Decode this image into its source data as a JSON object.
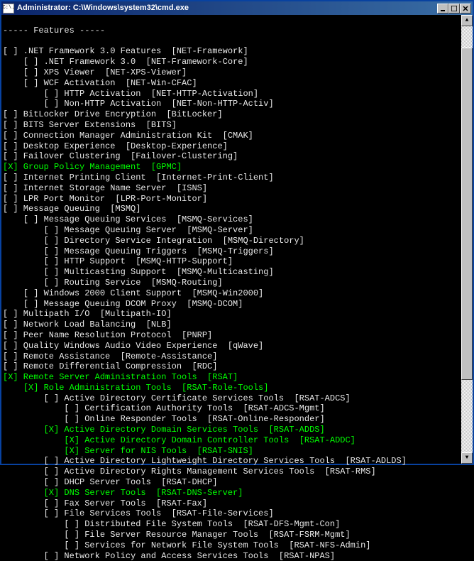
{
  "window": {
    "title": "Administrator: C:\\Windows\\system32\\cmd.exe",
    "icon_label": "C:\\."
  },
  "header": "----- Features -----",
  "lines": [
    {
      "indent": 0,
      "checked": false,
      "hl": false,
      "name": ".NET Framework 3.0 Features",
      "code": "NET-Framework"
    },
    {
      "indent": 1,
      "checked": false,
      "hl": false,
      "name": ".NET Framework 3.0",
      "code": "NET-Framework-Core"
    },
    {
      "indent": 1,
      "checked": false,
      "hl": false,
      "name": "XPS Viewer",
      "code": "NET-XPS-Viewer"
    },
    {
      "indent": 1,
      "checked": false,
      "hl": false,
      "name": "WCF Activation",
      "code": "NET-Win-CFAC"
    },
    {
      "indent": 2,
      "checked": false,
      "hl": false,
      "name": "HTTP Activation",
      "code": "NET-HTTP-Activation"
    },
    {
      "indent": 2,
      "checked": false,
      "hl": false,
      "name": "Non-HTTP Activation",
      "code": "NET-Non-HTTP-Activ"
    },
    {
      "indent": 0,
      "checked": false,
      "hl": false,
      "name": "BitLocker Drive Encryption",
      "code": "BitLocker"
    },
    {
      "indent": 0,
      "checked": false,
      "hl": false,
      "name": "BITS Server Extensions",
      "code": "BITS"
    },
    {
      "indent": 0,
      "checked": false,
      "hl": false,
      "name": "Connection Manager Administration Kit",
      "code": "CMAK"
    },
    {
      "indent": 0,
      "checked": false,
      "hl": false,
      "name": "Desktop Experience",
      "code": "Desktop-Experience"
    },
    {
      "indent": 0,
      "checked": false,
      "hl": false,
      "name": "Failover Clustering",
      "code": "Failover-Clustering"
    },
    {
      "indent": 0,
      "checked": true,
      "hl": true,
      "name": "Group Policy Management",
      "code": "GPMC"
    },
    {
      "indent": 0,
      "checked": false,
      "hl": false,
      "name": "Internet Printing Client",
      "code": "Internet-Print-Client"
    },
    {
      "indent": 0,
      "checked": false,
      "hl": false,
      "name": "Internet Storage Name Server",
      "code": "ISNS"
    },
    {
      "indent": 0,
      "checked": false,
      "hl": false,
      "name": "LPR Port Monitor",
      "code": "LPR-Port-Monitor"
    },
    {
      "indent": 0,
      "checked": false,
      "hl": false,
      "name": "Message Queuing",
      "code": "MSMQ"
    },
    {
      "indent": 1,
      "checked": false,
      "hl": false,
      "name": "Message Queuing Services",
      "code": "MSMQ-Services"
    },
    {
      "indent": 2,
      "checked": false,
      "hl": false,
      "name": "Message Queuing Server",
      "code": "MSMQ-Server"
    },
    {
      "indent": 2,
      "checked": false,
      "hl": false,
      "name": "Directory Service Integration",
      "code": "MSMQ-Directory"
    },
    {
      "indent": 2,
      "checked": false,
      "hl": false,
      "name": "Message Queuing Triggers",
      "code": "MSMQ-Triggers"
    },
    {
      "indent": 2,
      "checked": false,
      "hl": false,
      "name": "HTTP Support",
      "code": "MSMQ-HTTP-Support"
    },
    {
      "indent": 2,
      "checked": false,
      "hl": false,
      "name": "Multicasting Support",
      "code": "MSMQ-Multicasting"
    },
    {
      "indent": 2,
      "checked": false,
      "hl": false,
      "name": "Routing Service",
      "code": "MSMQ-Routing"
    },
    {
      "indent": 1,
      "checked": false,
      "hl": false,
      "name": "Windows 2000 Client Support",
      "code": "MSMQ-Win2000"
    },
    {
      "indent": 1,
      "checked": false,
      "hl": false,
      "name": "Message Queuing DCOM Proxy",
      "code": "MSMQ-DCOM"
    },
    {
      "indent": 0,
      "checked": false,
      "hl": false,
      "name": "Multipath I/O",
      "code": "Multipath-IO"
    },
    {
      "indent": 0,
      "checked": false,
      "hl": false,
      "name": "Network Load Balancing",
      "code": "NLB"
    },
    {
      "indent": 0,
      "checked": false,
      "hl": false,
      "name": "Peer Name Resolution Protocol",
      "code": "PNRP"
    },
    {
      "indent": 0,
      "checked": false,
      "hl": false,
      "name": "Quality Windows Audio Video Experience",
      "code": "qWave"
    },
    {
      "indent": 0,
      "checked": false,
      "hl": false,
      "name": "Remote Assistance",
      "code": "Remote-Assistance"
    },
    {
      "indent": 0,
      "checked": false,
      "hl": false,
      "name": "Remote Differential Compression",
      "code": "RDC"
    },
    {
      "indent": 0,
      "checked": true,
      "hl": true,
      "name": "Remote Server Administration Tools",
      "code": "RSAT"
    },
    {
      "indent": 1,
      "checked": true,
      "hl": true,
      "name": "Role Administration Tools",
      "code": "RSAT-Role-Tools"
    },
    {
      "indent": 2,
      "checked": false,
      "hl": false,
      "name": "Active Directory Certificate Services Tools",
      "code": "RSAT-ADCS"
    },
    {
      "indent": 3,
      "checked": false,
      "hl": false,
      "name": "Certification Authority Tools",
      "code": "RSAT-ADCS-Mgmt"
    },
    {
      "indent": 3,
      "checked": false,
      "hl": false,
      "name": "Online Responder Tools",
      "code": "RSAT-Online-Responder"
    },
    {
      "indent": 2,
      "checked": true,
      "hl": true,
      "name": "Active Directory Domain Services Tools",
      "code": "RSAT-ADDS"
    },
    {
      "indent": 3,
      "checked": true,
      "hl": true,
      "name": "Active Directory Domain Controller Tools",
      "code": "RSAT-ADDC"
    },
    {
      "indent": 3,
      "checked": true,
      "hl": true,
      "name": "Server for NIS Tools",
      "code": "RSAT-SNIS"
    },
    {
      "indent": 2,
      "checked": false,
      "hl": false,
      "name": "Active Directory Lightweight Directory Services Tools",
      "code": "RSAT-ADLDS"
    },
    {
      "indent": 2,
      "checked": false,
      "hl": false,
      "name": "Active Directory Rights Management Services Tools",
      "code": "RSAT-RMS"
    },
    {
      "indent": 2,
      "checked": false,
      "hl": false,
      "name": "DHCP Server Tools",
      "code": "RSAT-DHCP"
    },
    {
      "indent": 2,
      "checked": true,
      "hl": true,
      "name": "DNS Server Tools",
      "code": "RSAT-DNS-Server"
    },
    {
      "indent": 2,
      "checked": false,
      "hl": false,
      "name": "Fax Server Tools",
      "code": "RSAT-Fax"
    },
    {
      "indent": 2,
      "checked": false,
      "hl": false,
      "name": "File Services Tools",
      "code": "RSAT-File-Services"
    },
    {
      "indent": 3,
      "checked": false,
      "hl": false,
      "name": "Distributed File System Tools",
      "code": "RSAT-DFS-Mgmt-Con"
    },
    {
      "indent": 3,
      "checked": false,
      "hl": false,
      "name": "File Server Resource Manager Tools",
      "code": "RSAT-FSRM-Mgmt"
    },
    {
      "indent": 3,
      "checked": false,
      "hl": false,
      "name": "Services for Network File System Tools",
      "code": "RSAT-NFS-Admin"
    },
    {
      "indent": 2,
      "checked": false,
      "hl": false,
      "name": "Network Policy and Access Services Tools",
      "code": "RSAT-NPAS"
    }
  ]
}
